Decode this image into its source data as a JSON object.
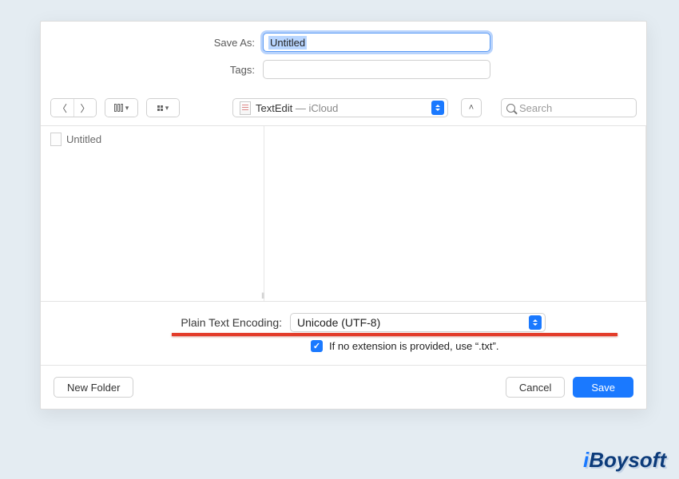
{
  "fields": {
    "save_as_label": "Save As:",
    "save_as_value": "Untitled",
    "tags_label": "Tags:",
    "tags_value": ""
  },
  "toolbar": {
    "location_app": "TextEdit",
    "location_separator": " — ",
    "location_place": "iCloud",
    "search_placeholder": "Search"
  },
  "browser": {
    "files": [
      {
        "name": "Untitled"
      }
    ]
  },
  "options": {
    "encoding_label": "Plain Text Encoding:",
    "encoding_value": "Unicode (UTF-8)",
    "extension_checked": true,
    "extension_label": "If no extension is provided, use “.txt”."
  },
  "footer": {
    "new_folder": "New Folder",
    "cancel": "Cancel",
    "save": "Save"
  },
  "brand": "iBoysoft"
}
